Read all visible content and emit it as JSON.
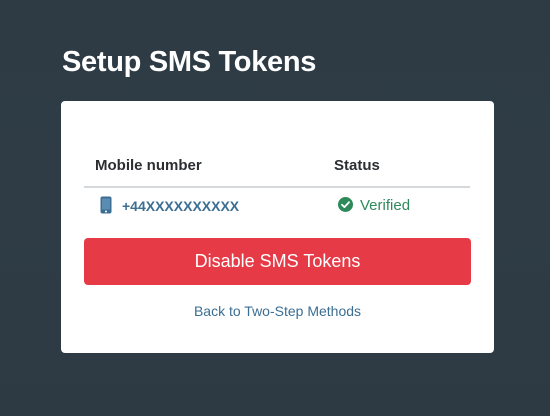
{
  "page": {
    "title": "Setup SMS Tokens"
  },
  "table": {
    "headers": {
      "mobile": "Mobile number",
      "status": "Status"
    },
    "rows": [
      {
        "mobile_number": "+44XXXXXXXXXX",
        "status": "Verified",
        "icon": "mobile-phone-icon",
        "status_icon": "check-circle-icon"
      }
    ]
  },
  "actions": {
    "disable_label": "Disable SMS Tokens",
    "back_label": "Back to Two-Step Methods"
  },
  "colors": {
    "background": "#2e3b44",
    "danger": "#e63a46",
    "link": "#3b6e93",
    "success": "#2e8a5b"
  }
}
